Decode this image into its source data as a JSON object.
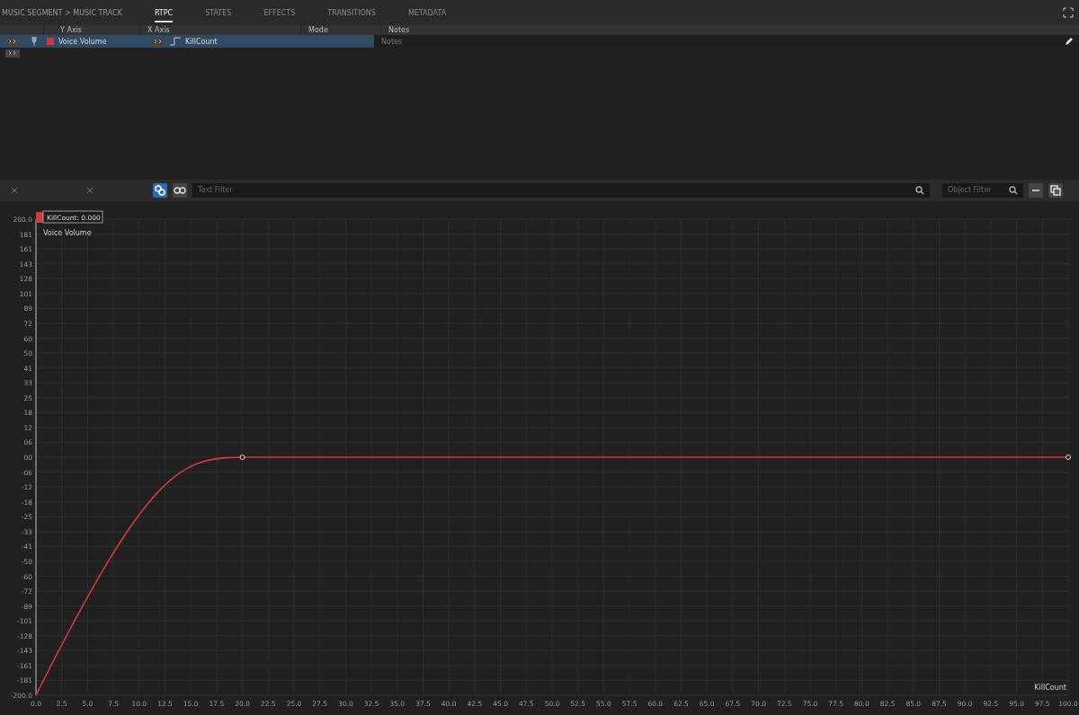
{
  "breadcrumb": "MUSIC SEGMENT > MUSIC TRACK",
  "tabs": [
    {
      "label": "RTPC",
      "selected": true
    },
    {
      "label": "STATES",
      "selected": false
    },
    {
      "label": "EFFECTS",
      "selected": false
    },
    {
      "label": "TRANSITIONS",
      "selected": false
    },
    {
      "label": "METADATA",
      "selected": false
    }
  ],
  "rtpc_table": {
    "columns": [
      "Y Axis",
      "X Axis",
      "Mode",
      "Notes"
    ],
    "rows": [
      {
        "y_axis": "Voice Volume",
        "color": "#d03a3a",
        "x_axis": "KillCount",
        "notes_placeholder": "Notes",
        "selected": true
      }
    ]
  },
  "toolbar": {
    "text_filter": {
      "placeholder": "Text Filter"
    },
    "object_filter": {
      "placeholder": "Object Filter"
    }
  },
  "graph": {
    "legend": "KillCount: 0.000",
    "curve_label": "Voice Volume",
    "x_axis_name": "KillCount",
    "y_labels": [
      "200.0",
      "181",
      "161",
      "143",
      "128",
      "101",
      "89",
      "72",
      "60",
      "50",
      "41",
      "33",
      "25",
      "18",
      "12",
      "06",
      "00",
      "-06",
      "-12",
      "-18",
      "-25",
      "-33",
      "-41",
      "-50",
      "-60",
      "-72",
      "-89",
      "-101",
      "-128",
      "-143",
      "-161",
      "-181",
      "-200.0"
    ],
    "x_labels": [
      "0.0",
      "2.5",
      "5.0",
      "7.5",
      "10.0",
      "12.5",
      "15.0",
      "17.5",
      "20.0",
      "22.5",
      "25.0",
      "27.5",
      "30.0",
      "32.5",
      "35.0",
      "37.5",
      "40.0",
      "42.5",
      "45.0",
      "47.5",
      "50.0",
      "52.5",
      "55.0",
      "57.5",
      "60.0",
      "62.5",
      "65.0",
      "67.5",
      "70.0",
      "72.5",
      "75.0",
      "77.5",
      "80.0",
      "82.5",
      "85.0",
      "87.5",
      "90.0",
      "92.5",
      "95.0",
      "97.5",
      "100.0"
    ]
  }
}
